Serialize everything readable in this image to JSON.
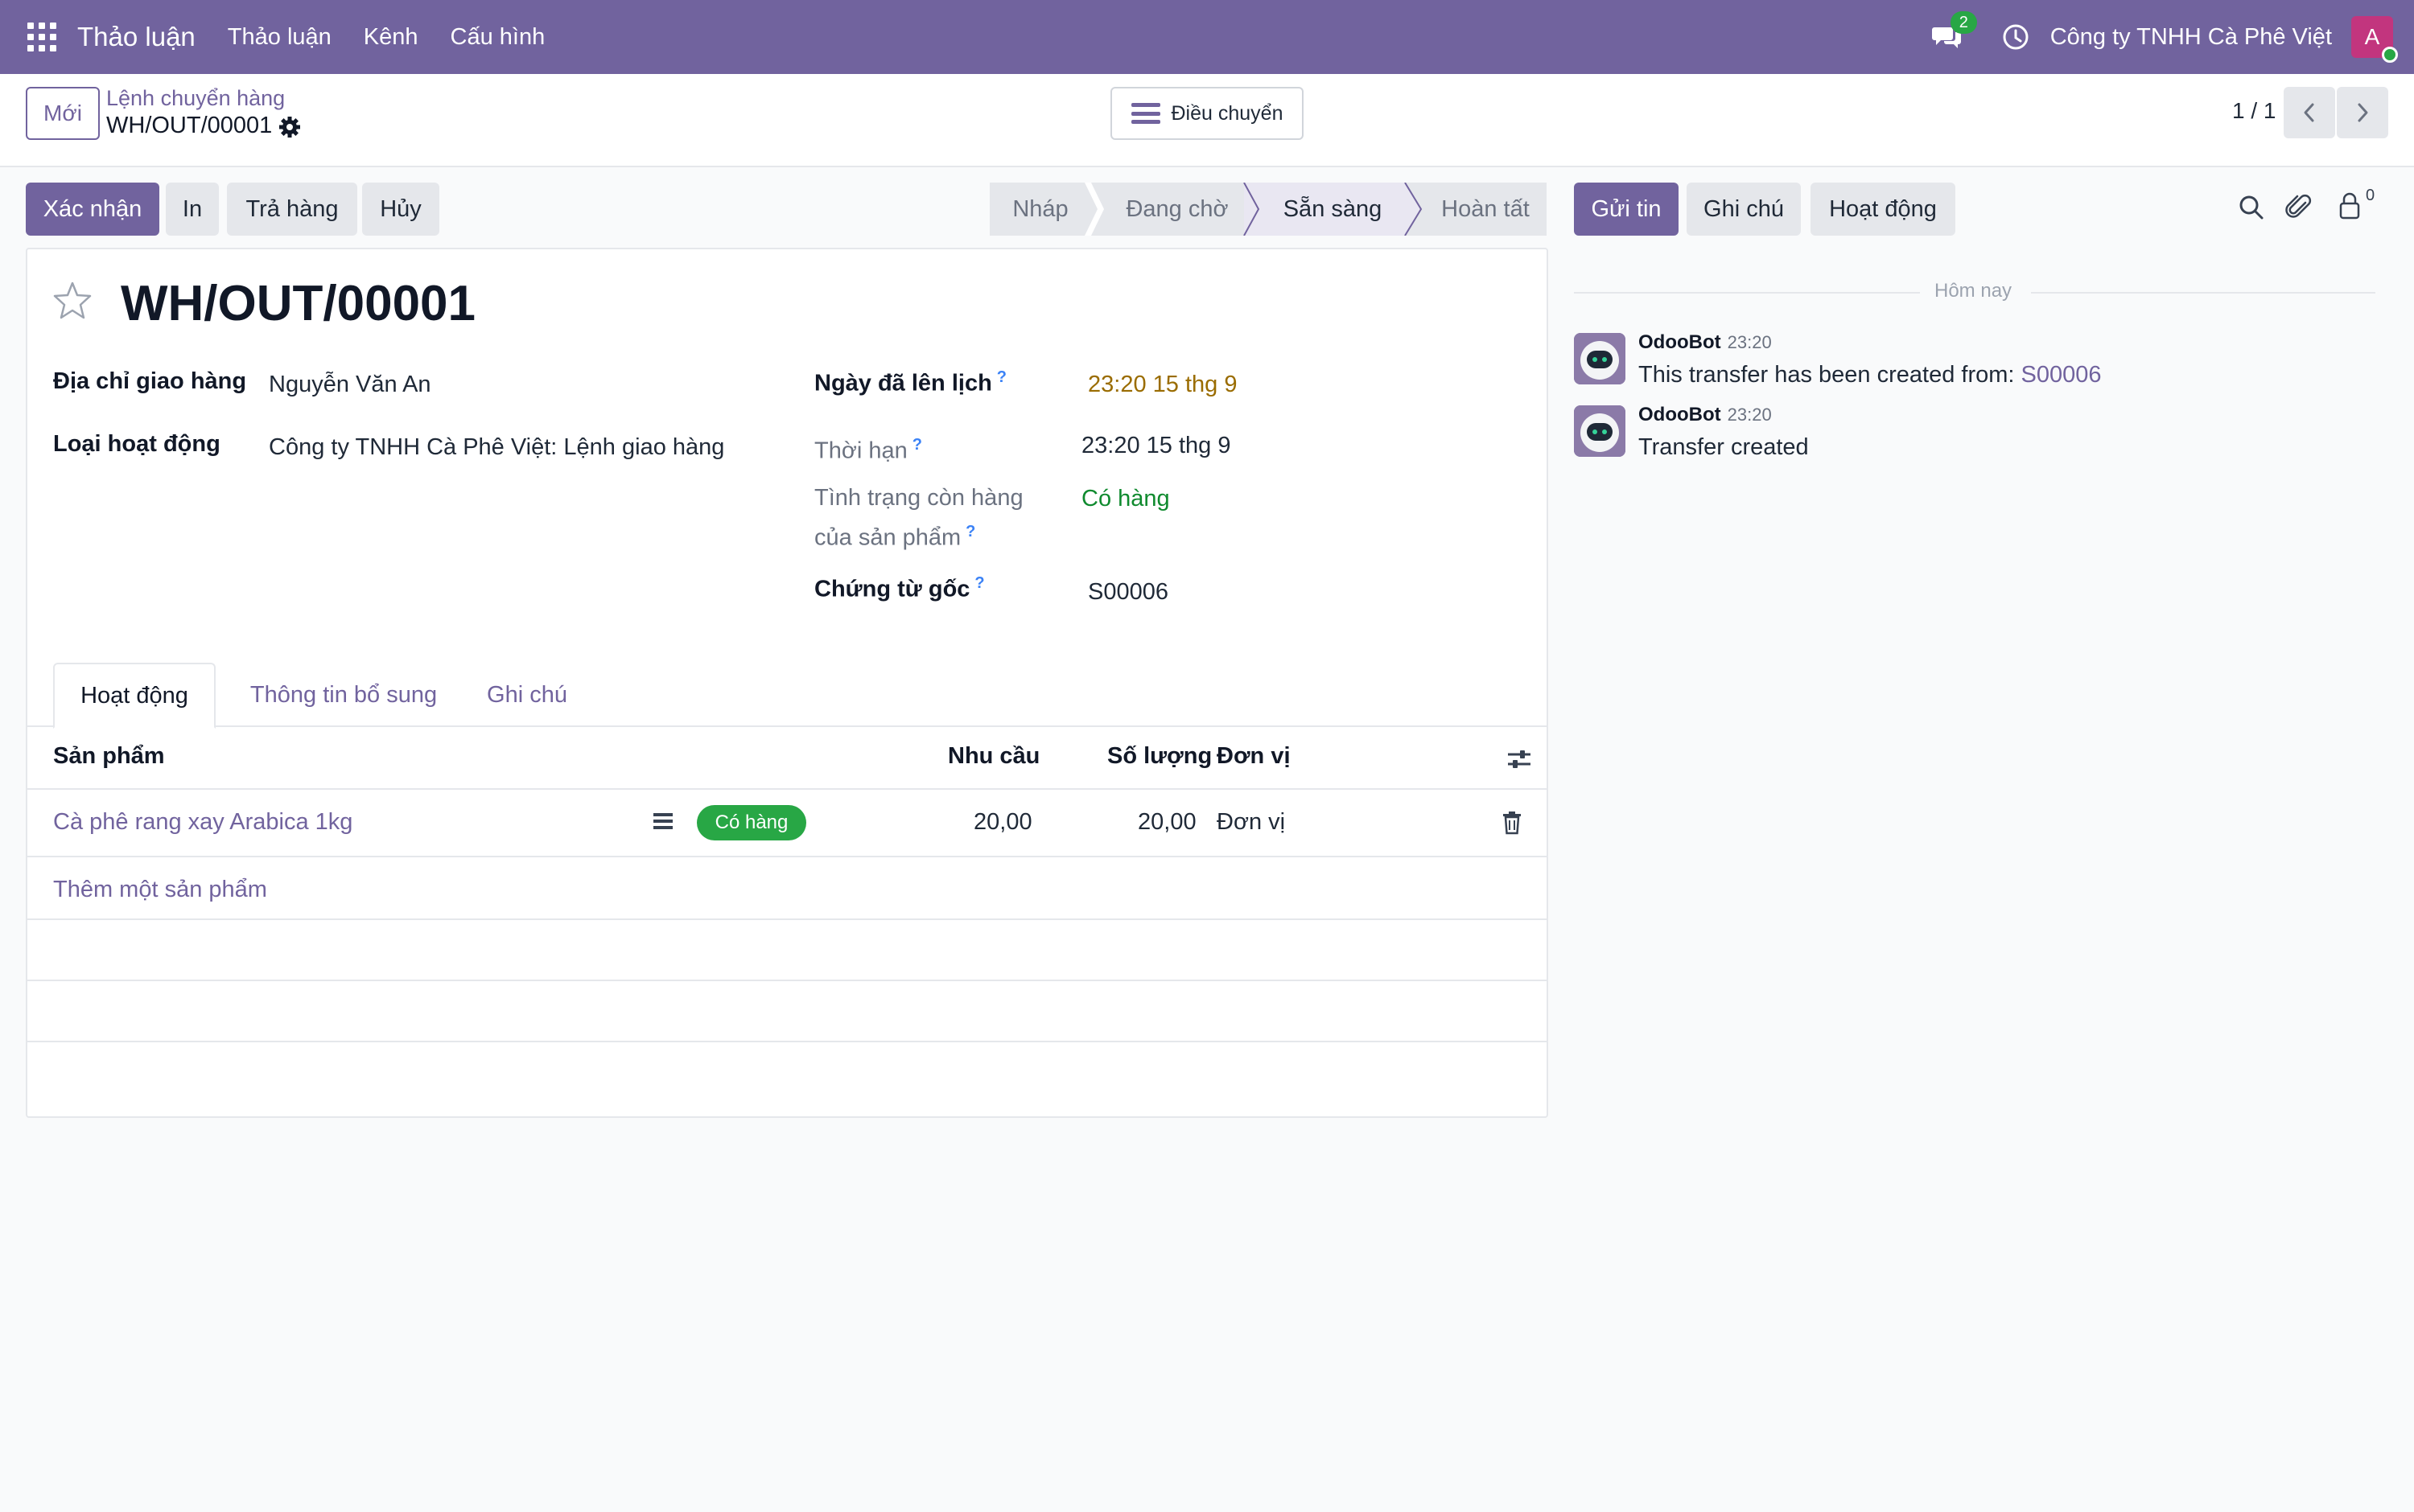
{
  "navbar": {
    "brand": "Thảo luận",
    "menu": [
      "Thảo luận",
      "Kênh",
      "Cấu hình"
    ],
    "chat_count": "2",
    "company": "Công ty TNHH Cà Phê Việt",
    "avatar_letter": "A",
    "color": "#71639e"
  },
  "control_panel": {
    "new_label": "Mới",
    "breadcrumb_parent": "Lệnh chuyển hàng",
    "breadcrumb_current": "WH/OUT/00001",
    "transfer_label": "Điều chuyển",
    "pager_value": "1 / 1"
  },
  "actions": {
    "confirm": "Xác nhận",
    "print": "In",
    "return": "Trả hàng",
    "cancel": "Hủy"
  },
  "status_stages": [
    "Nháp",
    "Đang chờ",
    "Sẵn sàng",
    "Hoàn tất"
  ],
  "status_active": "Sẵn sàng",
  "form": {
    "title": "WH/OUT/00001",
    "delivery_address_label": "Địa chỉ giao hàng",
    "delivery_address_value": "Nguyễn Văn An",
    "operation_type_label": "Loại hoạt động",
    "operation_type_value": "Công ty TNHH Cà Phê Việt: Lệnh giao hàng",
    "scheduled_date_label": "Ngày đã lên lịch",
    "scheduled_date_value": "23:20 15 thg 9",
    "deadline_label": "Thời hạn",
    "deadline_value": "23:20 15 thg 9",
    "availability_label_1": "Tình trạng còn hàng",
    "availability_label_2": "của sản phẩm",
    "availability_value": "Có hàng",
    "source_document_label": "Chứng từ gốc",
    "source_document_value": "S00006",
    "help_mark": "?"
  },
  "tabs": [
    "Hoạt động",
    "Thông tin bổ sung",
    "Ghi chú"
  ],
  "table": {
    "headers": {
      "product": "Sản phẩm",
      "demand": "Nhu cầu",
      "quantity": "Số lượng",
      "uom": "Đơn vị"
    },
    "rows": [
      {
        "product": "Cà phê rang xay Arabica 1kg",
        "badge": "Có hàng",
        "demand": "20,00",
        "quantity": "20,00",
        "uom": "Đơn vị"
      }
    ],
    "add_line": "Thêm một sản phẩm"
  },
  "chatter": {
    "send_message": "Gửi tin",
    "log_note": "Ghi chú",
    "activity": "Hoạt động",
    "follower_count": "0",
    "separator": "Hôm nay",
    "messages": [
      {
        "author": "OdooBot",
        "time": "23:20",
        "body": "This transfer has been created from: ",
        "link": "S00006"
      },
      {
        "author": "OdooBot",
        "time": "23:20",
        "body": "Transfer created",
        "link": ""
      }
    ]
  },
  "colors": {
    "primary": "#71639e",
    "success": "#28a745",
    "warning_text": "#9a6c00",
    "success_text": "#0f8a2e",
    "link": "#71639e"
  }
}
